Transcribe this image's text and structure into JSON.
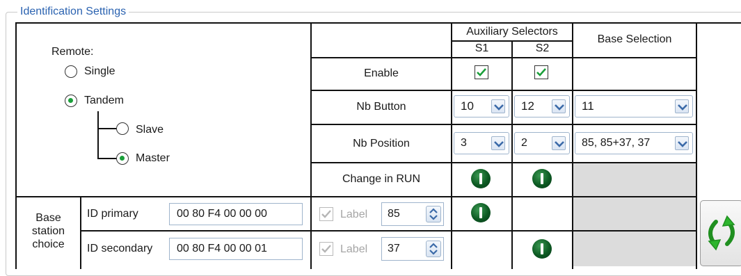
{
  "group": {
    "title": "Identification Settings"
  },
  "remote": {
    "label": "Remote:",
    "options": [
      {
        "label": "Single",
        "selected": false
      },
      {
        "label": "Tandem",
        "selected": true
      }
    ],
    "tandem_options": [
      {
        "label": "Slave",
        "selected": false
      },
      {
        "label": "Master",
        "selected": true
      }
    ]
  },
  "table": {
    "headers": {
      "auxiliary_selectors": "Auxiliary Selectors",
      "s1": "S1",
      "s2": "S2",
      "base_selection": "Base Selection"
    },
    "rows": {
      "enable": {
        "label": "Enable",
        "s1_checked": true,
        "s2_checked": true
      },
      "nb_button": {
        "label": "Nb Button",
        "s1": "10",
        "s2": "12",
        "base": "11"
      },
      "nb_position": {
        "label": "Nb Position",
        "s1": "3",
        "s2": "2",
        "base": "85, 85+37, 37"
      },
      "change_in_run": {
        "label": "Change in RUN",
        "s1_icon": "power-icon",
        "s2_icon": "power-icon"
      }
    }
  },
  "base_station": {
    "label": "Base station choice",
    "label_lines": [
      "Base",
      "station",
      "choice"
    ],
    "primary": {
      "label": "ID primary",
      "value": "00 80 F4 00 00 00",
      "checkbox_label": "Label",
      "spin_value": "85",
      "checked": true,
      "s1_icon": "power-icon"
    },
    "secondary": {
      "label": "ID secondary",
      "value": "00 80 F4 00 00 01",
      "checkbox_label": "Label",
      "spin_value": "37",
      "checked": true,
      "s2_icon": "power-icon"
    },
    "refresh_icon": "refresh-arrows-icon"
  },
  "colors": {
    "title": "#2a62b0",
    "radio_selected": "#1a9f3a",
    "check": "#1a9f3a",
    "power_button": "#0d5a23",
    "field_border": "#9fb4cc",
    "shaded_cell": "#dcdcdc",
    "refresh_arrows": "#2db52d"
  }
}
